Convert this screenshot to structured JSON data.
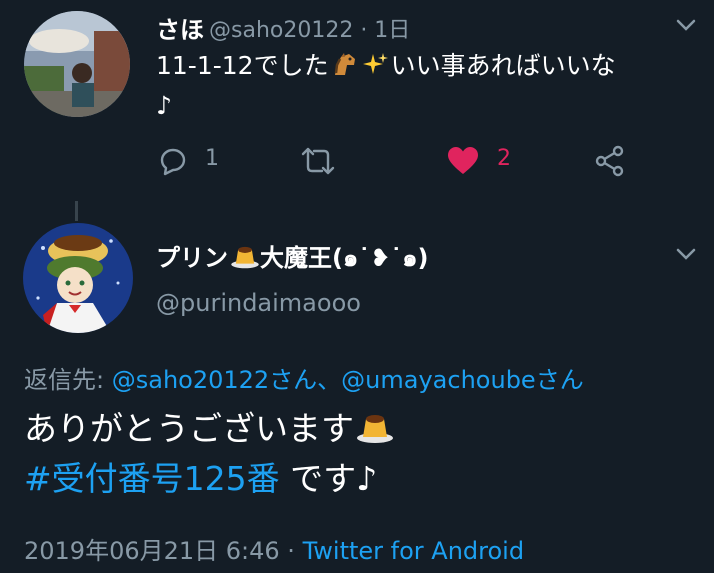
{
  "tweet1": {
    "name": "さほ",
    "handle_time": "@saho20122 · 1日",
    "text_before": "11-1-12でした",
    "text_after": "いい事あればいいな",
    "text_line2": "♪",
    "reply_count": "1",
    "like_count": "2"
  },
  "tweet2": {
    "name_part1": "プリン",
    "name_part2": "大魔王(๑˙❥˙๑)",
    "handle": "@purindaimaooo",
    "replying_label": "返信先:",
    "replying_users": "@saho20122さん、@umayachoubeさん",
    "body_line1": "ありがとうございます",
    "hashtag": "#受付番号125番",
    "body_line2_rest": " です♪",
    "timestamp": "2019年06月21日 6:46 · ",
    "source": "Twitter for Android"
  },
  "colors": {
    "background": "#141d26",
    "muted": "#8899a6",
    "link": "#1da1f2",
    "like": "#e0245e"
  },
  "icons": [
    "avatar-photo",
    "chevron-down-icon",
    "horse-emoji-icon",
    "sparkles-emoji-icon",
    "reply-icon",
    "retweet-icon",
    "heart-icon",
    "share-icon",
    "pudding-emoji-icon"
  ]
}
